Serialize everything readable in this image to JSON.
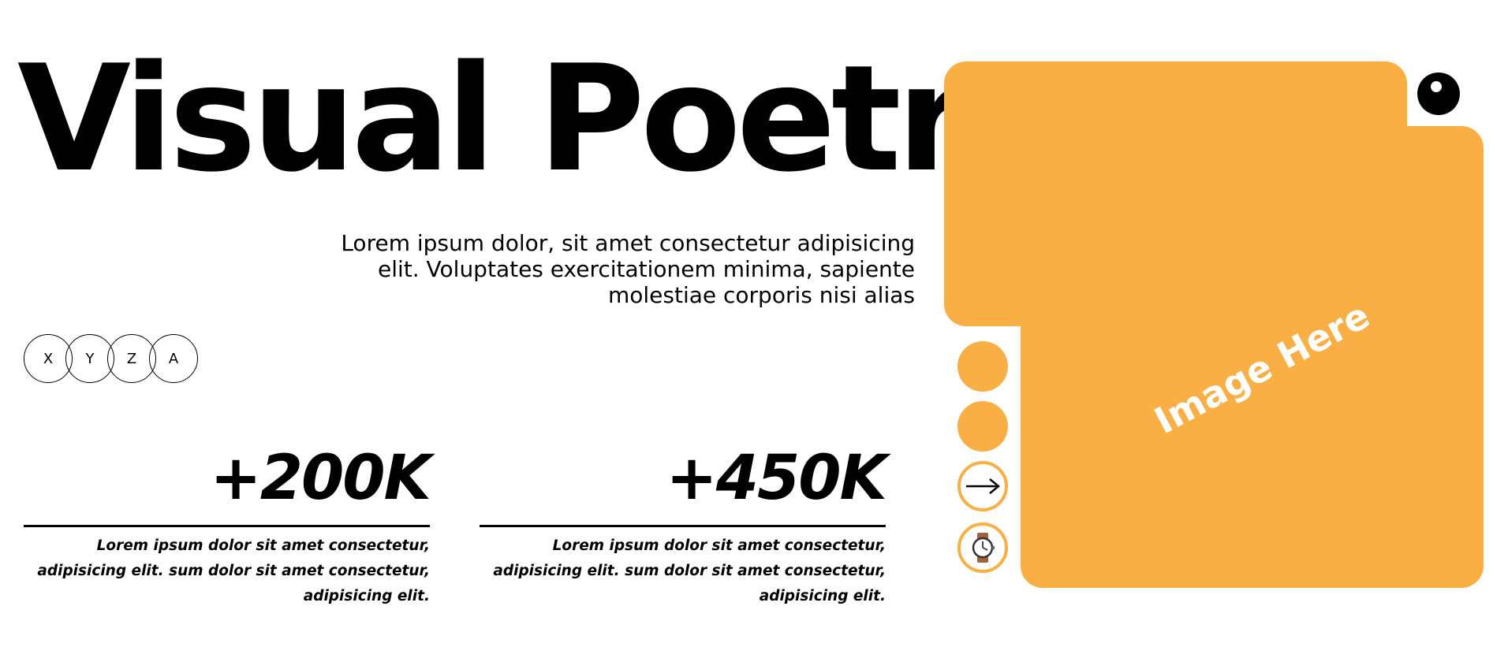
{
  "hero": {
    "title": "Visual Poetry",
    "subtitle": "Lorem ipsum dolor, sit amet consectetur adipisicing elit. Voluptates exercitationem minima, sapiente molestiae corporis nisi alias"
  },
  "chips": [
    {
      "label": "X"
    },
    {
      "label": "Y"
    },
    {
      "label": "Z"
    },
    {
      "label": "A"
    }
  ],
  "stats": [
    {
      "value": "+200K",
      "description": "Lorem ipsum dolor sit amet consectetur, adipisicing elit. sum dolor sit amet consectetur, adipisicing elit."
    },
    {
      "value": "+450K",
      "description": "Lorem ipsum dolor sit amet consectetur, adipisicing elit. sum dolor sit amet consectetur, adipisicing elit."
    }
  ],
  "panel": {
    "image_placeholder": "Image Here",
    "accent_color": "#f9af44"
  },
  "side_buttons": [
    {
      "icon": "circle-icon"
    },
    {
      "icon": "circle-icon"
    },
    {
      "icon": "arrow-right-icon"
    },
    {
      "icon": "watch-icon"
    }
  ]
}
